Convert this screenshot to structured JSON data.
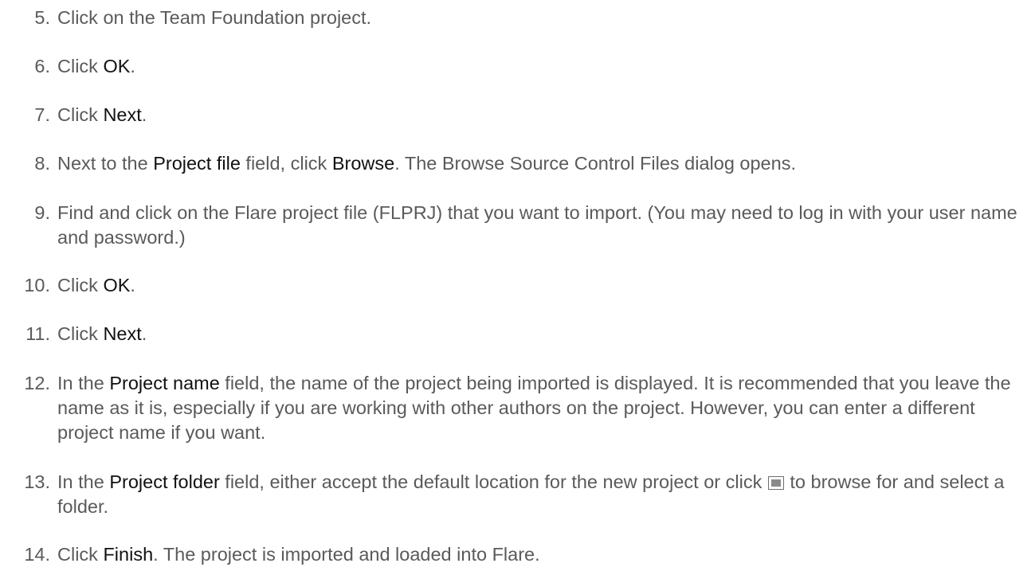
{
  "steps": [
    {
      "num": "5.",
      "parts": [
        {
          "t": "Click on the Team Foundation project."
        }
      ]
    },
    {
      "num": "6.",
      "parts": [
        {
          "t": "Click "
        },
        {
          "t": "OK",
          "b": true
        },
        {
          "t": "."
        }
      ]
    },
    {
      "num": "7.",
      "parts": [
        {
          "t": "Click "
        },
        {
          "t": "Next",
          "b": true
        },
        {
          "t": "."
        }
      ]
    },
    {
      "num": "8.",
      "parts": [
        {
          "t": "Next to the "
        },
        {
          "t": "Project file",
          "b": true
        },
        {
          "t": " field, click "
        },
        {
          "t": "Browse",
          "b": true
        },
        {
          "t": ". The Browse Source Control Files dialog opens."
        }
      ]
    },
    {
      "num": "9.",
      "parts": [
        {
          "t": "Find and click on the Flare project file (FLPRJ) that you want to import. (You may need to log in with your user name and password.)"
        }
      ]
    },
    {
      "num": "10.",
      "parts": [
        {
          "t": "Click "
        },
        {
          "t": "OK",
          "b": true
        },
        {
          "t": "."
        }
      ]
    },
    {
      "num": "11.",
      "parts": [
        {
          "t": "Click "
        },
        {
          "t": "Next",
          "b": true
        },
        {
          "t": "."
        }
      ]
    },
    {
      "num": "12.",
      "parts": [
        {
          "t": "In the "
        },
        {
          "t": "Project name",
          "b": true
        },
        {
          "t": " field, the name of the project being imported is displayed. It is recommended that you leave the name as it is, especially if you are working with other authors on the project. However, you can enter a different project name if you want."
        }
      ]
    },
    {
      "num": "13.",
      "parts": [
        {
          "t": "In the "
        },
        {
          "t": "Project folder",
          "b": true
        },
        {
          "t": " field, either accept the default location for the new project or click "
        },
        {
          "icon": "browse-icon"
        },
        {
          "t": " to browse for and select a folder."
        }
      ]
    },
    {
      "num": "14.",
      "parts": [
        {
          "t": "Click "
        },
        {
          "t": "Finish",
          "b": true
        },
        {
          "t": ". The project is imported and loaded into Flare."
        }
      ]
    }
  ]
}
